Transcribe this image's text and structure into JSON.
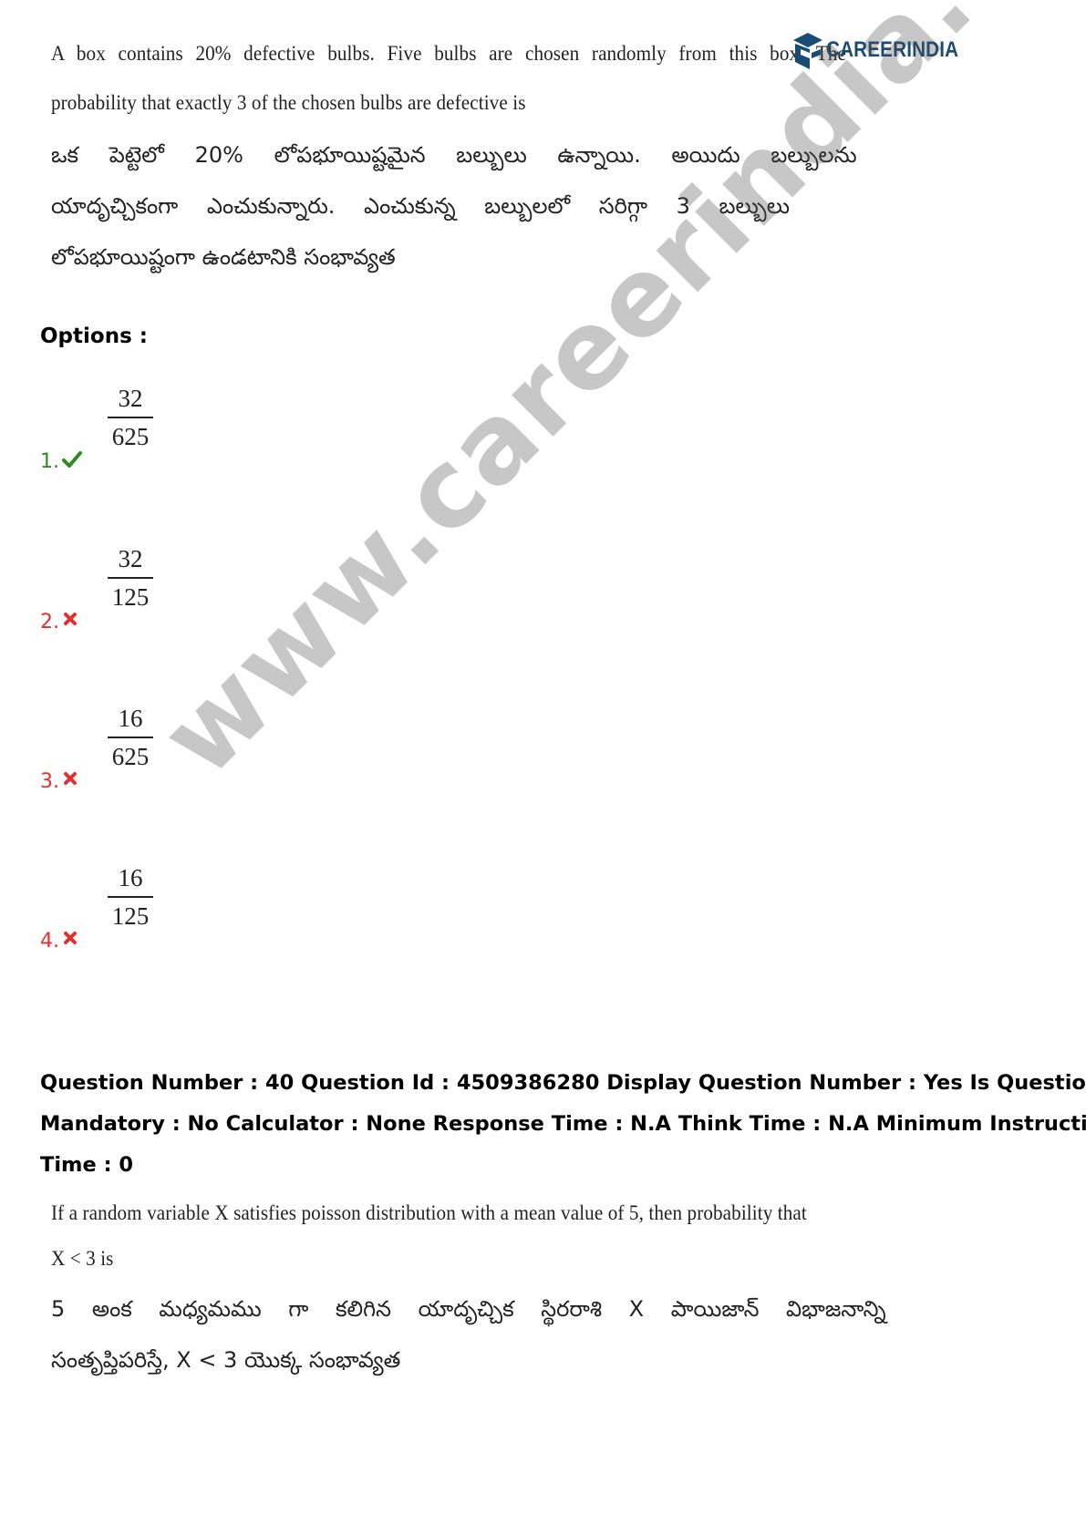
{
  "question1": {
    "english_lines": [
      "A box contains 20% defective bulbs. Five bulbs are chosen randomly from this box. The",
      "probability that exactly 3 of the chosen bulbs are defective is"
    ],
    "telugu_lines": [
      "ఒక పెట్టెలో 20% లోపభూయిష్టమైన బల్బులు ఉన్నాయి. అయిదు బల్బులను",
      "యాదృచ్చికంగా ఎంచుకున్నారు. ఎంచుకున్న బల్బులలో సరిగ్గా 3 బల్బులు",
      "లోపభూయిష్టంగా ఉండటానికి సంభావ్యత"
    ]
  },
  "logo": {
    "text_main": "CAREER",
    "text_accent": "INDIA",
    "icon": "graduation-cap-icon"
  },
  "options_label": "Options :",
  "options": [
    {
      "number": "1.",
      "numerator": "32",
      "denominator": "625",
      "status": "correct",
      "icon": "check-icon"
    },
    {
      "number": "2.",
      "numerator": "32",
      "denominator": "125",
      "status": "wrong",
      "icon": "cross-icon"
    },
    {
      "number": "3.",
      "numerator": "16",
      "denominator": "625",
      "status": "wrong",
      "icon": "cross-icon"
    },
    {
      "number": "4.",
      "numerator": "16",
      "denominator": "125",
      "status": "wrong",
      "icon": "cross-icon"
    }
  ],
  "meta_lines": [
    "Question Number : 40 Question Id : 4509386280 Display Question Number : Yes Is Question",
    "Mandatory : No Calculator : None Response Time : N.A Think Time : N.A Minimum Instruction",
    "Time : 0"
  ],
  "question2": {
    "english_lines": [
      "If a random variable X satisfies poisson distribution with a mean value of 5, then probability that",
      "X < 3 is"
    ],
    "telugu_lines": [
      "5 అంక మధ్యమము గా కలిగిన యాదృచ్చిక స్థిరరాశి X పాయిజాన్ విభాజనాన్ని",
      "సంతృప్తిపరిస్తే, X < 3 యొక్క సంభావ్యత"
    ]
  },
  "watermark": "www.careerindia.com",
  "colors": {
    "correct": "#2e8b20",
    "wrong": "#e03030",
    "brand": "#1a4b74"
  }
}
